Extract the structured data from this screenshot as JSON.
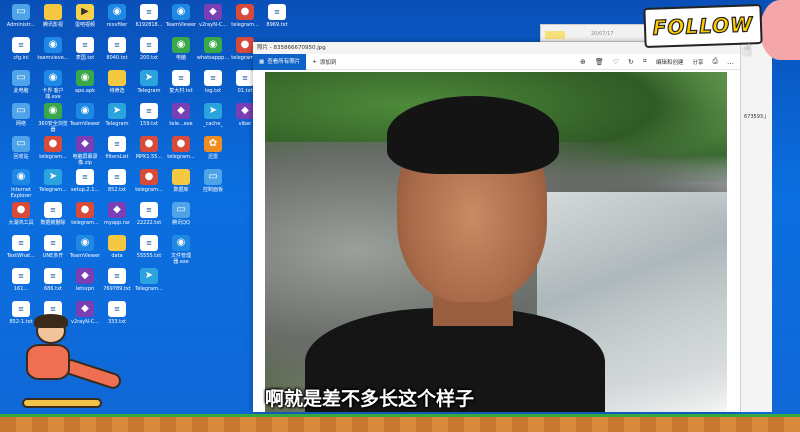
{
  "photo_window": {
    "title": "照片 - 835866670950.jpg",
    "view_all": "查看所有照片",
    "add": "添加到",
    "edit_create": "编辑和创建",
    "share": "分享"
  },
  "subtitle": "啊就是差不多长这个样子",
  "follow_badge": "FOLLOW",
  "side_window_label": "673593.j",
  "back_window_date": "20/07/17",
  "desktop_icons": [
    {
      "label": "Administr...",
      "type": "pc"
    },
    {
      "label": "腾讯影视",
      "type": "folder"
    },
    {
      "label": "蛋吧视频",
      "type": "yellow"
    },
    {
      "label": "rxxvfiler",
      "type": "blue"
    },
    {
      "label": "6192818...",
      "type": "txt"
    },
    {
      "label": "TeamViewer",
      "type": "blue"
    },
    {
      "label": "v2rayN-C...",
      "type": "purple"
    },
    {
      "label": "telegram...",
      "type": "red"
    },
    {
      "label": "8969.txt",
      "type": "txt"
    },
    {
      "label": "cfg.ini",
      "type": "txt"
    },
    {
      "label": "teamvieve...",
      "type": "blue"
    },
    {
      "label": "表国.txt",
      "type": "txt"
    },
    {
      "label": "8040.txt",
      "type": "txt"
    },
    {
      "label": "200.txt",
      "type": "txt"
    },
    {
      "label": "电脑",
      "type": "green"
    },
    {
      "label": "whatsappp...",
      "type": "green"
    },
    {
      "label": "telegram...",
      "type": "red"
    },
    {
      "label": "此电脑",
      "type": "pc"
    },
    {
      "label": "卡界·客户端.exe",
      "type": "blue"
    },
    {
      "label": "apo.apk",
      "type": "green"
    },
    {
      "label": "待筛选",
      "type": "folder"
    },
    {
      "label": "Telegram",
      "type": "tg"
    },
    {
      "label": "复大村.txt",
      "type": "txt"
    },
    {
      "label": "log.txt",
      "type": "txt"
    },
    {
      "label": "01.txt",
      "type": "txt"
    },
    {
      "label": "网络",
      "type": "pc"
    },
    {
      "label": "360安全浏览器",
      "type": "green"
    },
    {
      "label": "TeamViewer",
      "type": "blue"
    },
    {
      "label": "Telegram",
      "type": "tg"
    },
    {
      "label": "159.txt",
      "type": "txt"
    },
    {
      "label": "tele...exe",
      "type": "purple"
    },
    {
      "label": "_cache_",
      "type": "tg"
    },
    {
      "label": "viber",
      "type": "purple"
    },
    {
      "label": "回收站",
      "type": "pc"
    },
    {
      "label": "telegram...",
      "type": "red"
    },
    {
      "label": "电脑屏幕录像.zip",
      "type": "purple"
    },
    {
      "label": "filtersList",
      "type": "txt"
    },
    {
      "label": "MPK1.55...",
      "type": "red"
    },
    {
      "label": "telegram...",
      "type": "red"
    },
    {
      "label": "迅雷",
      "type": "orange"
    },
    {
      "label": "Internet Explorer",
      "type": "blue"
    },
    {
      "label": "Telegram...",
      "type": "tg"
    },
    {
      "label": "setup.2.1...",
      "type": "txt"
    },
    {
      "label": "852.txt",
      "type": "txt"
    },
    {
      "label": "telegram...",
      "type": "red"
    },
    {
      "label": "数据库",
      "type": "folder"
    },
    {
      "label": "控制面板",
      "type": "pc"
    },
    {
      "label": "大湖鸿工具",
      "type": "red"
    },
    {
      "label": "数据被删除",
      "type": "txt"
    },
    {
      "label": "telegram...",
      "type": "red"
    },
    {
      "label": "myapp.rar",
      "type": "purple"
    },
    {
      "label": "22222.txt",
      "type": "txt"
    },
    {
      "label": "腾讯QQ",
      "type": "pc"
    },
    {
      "label": "TextWhat...",
      "type": "txt"
    },
    {
      "label": "UNE多开",
      "type": "txt"
    },
    {
      "label": "TeamViewer",
      "type": "blue"
    },
    {
      "label": "data",
      "type": "folder"
    },
    {
      "label": "55555.txt",
      "type": "txt"
    },
    {
      "label": "文件管理器.exe",
      "type": "blue"
    },
    {
      "label": "161...",
      "type": "txt"
    },
    {
      "label": "686.txt",
      "type": "txt"
    },
    {
      "label": "letsvpn",
      "type": "purple"
    },
    {
      "label": "769789.txt",
      "type": "txt"
    },
    {
      "label": "Telegram...",
      "type": "tg"
    },
    {
      "label": "852-1.txt",
      "type": "txt"
    },
    {
      "label": "注册.txt",
      "type": "txt"
    },
    {
      "label": "v2rayN-C...",
      "type": "purple"
    },
    {
      "label": "333.txt",
      "type": "txt"
    }
  ],
  "colors": {
    "desktop": "#0b6fe0",
    "window_accent": "#0f62c8",
    "follow_text": "#ffcc00"
  }
}
